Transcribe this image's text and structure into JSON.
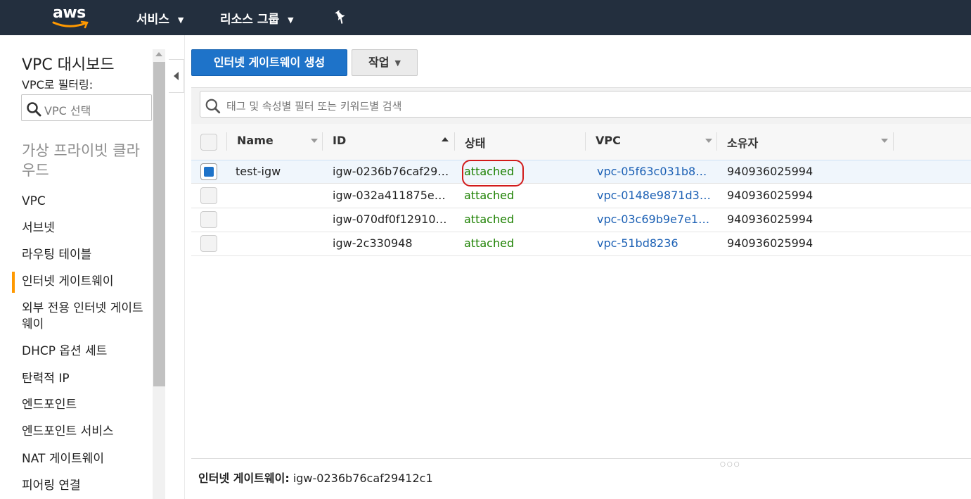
{
  "topnav": {
    "logo_text": "aws",
    "services_label": "서비스",
    "resource_groups_label": "리소스 그룹",
    "pin_icon": "pin-icon"
  },
  "sidebar": {
    "title": "VPC 대시보드",
    "filter_label": "VPC로 필터링:",
    "select_placeholder": "VPC 선택",
    "section_title": "가상 프라이빗 클라우드",
    "items": [
      {
        "label": "VPC"
      },
      {
        "label": "서브넷"
      },
      {
        "label": "라우팅 테이블"
      },
      {
        "label": "인터넷 게이트웨이",
        "active": true
      },
      {
        "label": "외부 전용 인터넷 게이트웨이"
      },
      {
        "label": "DHCP 옵션 세트"
      },
      {
        "label": "탄력적 IP"
      },
      {
        "label": "엔드포인트"
      },
      {
        "label": "엔드포인트 서비스"
      },
      {
        "label": "NAT 게이트웨이"
      },
      {
        "label": "피어링 연결"
      }
    ]
  },
  "toolbar": {
    "create_label": "인터넷 게이트웨이 생성",
    "actions_label": "작업"
  },
  "search": {
    "placeholder": "태그 및 속성별 필터 또는 키워드별 검색"
  },
  "table": {
    "columns": [
      "Name",
      "ID",
      "상태",
      "VPC",
      "소유자"
    ],
    "rows": [
      {
        "name": "test-igw",
        "id": "igw-0236b76caf29…",
        "state": "attached",
        "vpc": "vpc-05f63c031b8…",
        "owner": "940936025994",
        "selected": true
      },
      {
        "name": "",
        "id": "igw-032a411875e…",
        "state": "attached",
        "vpc": "vpc-0148e9871d3…",
        "owner": "940936025994",
        "selected": false
      },
      {
        "name": "",
        "id": "igw-070df0f12910…",
        "state": "attached",
        "vpc": "vpc-03c69b9e7e1…",
        "owner": "940936025994",
        "selected": false
      },
      {
        "name": "",
        "id": "igw-2c330948",
        "state": "attached",
        "vpc": "vpc-51bd8236",
        "owner": "940936025994",
        "selected": false
      }
    ]
  },
  "detail": {
    "label": "인터넷 게이트웨이:",
    "value": "igw-0236b76caf29412c1"
  },
  "colors": {
    "nav_bg": "#232f3e",
    "primary": "#1e73c9",
    "attached_green": "#1d8102",
    "link_blue": "#1a5fb4",
    "active_bar": "#ff9900",
    "annotation_red": "#d21b1b"
  }
}
